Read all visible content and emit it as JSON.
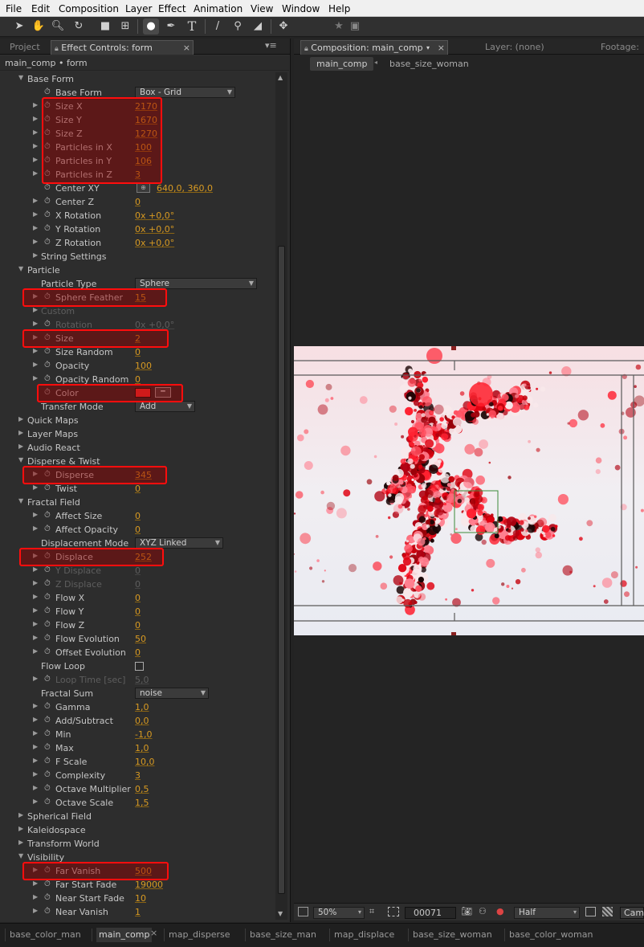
{
  "menu": [
    "File",
    "Edit",
    "Composition",
    "Layer",
    "Effect",
    "Animation",
    "View",
    "Window",
    "Help"
  ],
  "left_tabs": {
    "project": "Project",
    "effect_controls": "Effect Controls: form",
    "close": "×"
  },
  "breadcrumb": "main_comp • form",
  "props": [
    {
      "l": "Base Form",
      "d": 0,
      "t": "o",
      "grp": 1
    },
    {
      "l": "Base Form",
      "d": 2,
      "t": "n",
      "dd": "Box - Grid",
      "sw": 1
    },
    {
      "l": "Size X",
      "d": 2,
      "t": "c",
      "v": "2170",
      "sw": 1
    },
    {
      "l": "Size Y",
      "d": 2,
      "t": "c",
      "v": "1670",
      "sw": 1
    },
    {
      "l": "Size Z",
      "d": 2,
      "t": "c",
      "v": "1270",
      "sw": 1
    },
    {
      "l": "Particles in X",
      "d": 2,
      "t": "c",
      "v": "100",
      "sw": 1
    },
    {
      "l": "Particles in Y",
      "d": 2,
      "t": "c",
      "v": "106",
      "sw": 1
    },
    {
      "l": "Particles in Z",
      "d": 2,
      "t": "c",
      "v": "3",
      "sw": 1
    },
    {
      "l": "Center XY",
      "d": 2,
      "t": "n",
      "v": "640,0, 360,0",
      "sw": 1,
      "xy": 1
    },
    {
      "l": "Center Z",
      "d": 2,
      "t": "c",
      "v": "0",
      "sw": 1
    },
    {
      "l": "X Rotation",
      "d": 2,
      "t": "c",
      "v": "0x +0,0°",
      "sw": 1
    },
    {
      "l": "Y Rotation",
      "d": 2,
      "t": "c",
      "v": "0x +0,0°",
      "sw": 1
    },
    {
      "l": "Z Rotation",
      "d": 2,
      "t": "c",
      "v": "0x +0,0°",
      "sw": 1
    },
    {
      "l": "String Settings",
      "d": 1,
      "t": "c"
    },
    {
      "l": "Particle",
      "d": 0,
      "t": "o",
      "grp": 1
    },
    {
      "l": "Particle Type",
      "d": 1,
      "t": "n",
      "dd": "Sphere"
    },
    {
      "l": "Sphere Feather",
      "d": 2,
      "t": "c",
      "v": "15",
      "sw": 1
    },
    {
      "l": "Custom",
      "d": 1,
      "t": "c",
      "dim": 1
    },
    {
      "l": "Rotation",
      "d": 2,
      "t": "c",
      "v": "0x +0,0°",
      "sw": 1,
      "dim": 1
    },
    {
      "l": "Size",
      "d": 2,
      "t": "c",
      "v": "2",
      "sw": 1
    },
    {
      "l": "Size Random",
      "d": 2,
      "t": "c",
      "v": "0",
      "sw": 1
    },
    {
      "l": "Opacity",
      "d": 2,
      "t": "c",
      "v": "100",
      "sw": 1
    },
    {
      "l": "Opacity Random",
      "d": 2,
      "t": "c",
      "v": "0",
      "sw": 1
    },
    {
      "l": "Color",
      "d": 2,
      "t": "n",
      "sw": 1,
      "color": "#ff3030"
    },
    {
      "l": "Transfer Mode",
      "d": 1,
      "t": "n",
      "dd": "Add"
    },
    {
      "l": "Quick Maps",
      "d": 0,
      "t": "c",
      "grp": 1
    },
    {
      "l": "Layer Maps",
      "d": 0,
      "t": "c",
      "grp": 1
    },
    {
      "l": "Audio React",
      "d": 0,
      "t": "c",
      "grp": 1
    },
    {
      "l": "Disperse & Twist",
      "d": 0,
      "t": "o",
      "grp": 1
    },
    {
      "l": "Disperse",
      "d": 2,
      "t": "c",
      "v": "345",
      "sw": 1
    },
    {
      "l": "Twist",
      "d": 2,
      "t": "c",
      "v": "0",
      "sw": 1
    },
    {
      "l": "Fractal Field",
      "d": 0,
      "t": "o",
      "grp": 1
    },
    {
      "l": "Affect Size",
      "d": 2,
      "t": "c",
      "v": "0",
      "sw": 1
    },
    {
      "l": "Affect Opacity",
      "d": 2,
      "t": "c",
      "v": "0",
      "sw": 1
    },
    {
      "l": "Displacement Mode",
      "d": 1,
      "t": "n",
      "dd": "XYZ Linked"
    },
    {
      "l": "Displace",
      "d": 2,
      "t": "c",
      "v": "252",
      "sw": 1
    },
    {
      "l": "Y Displace",
      "d": 2,
      "t": "c",
      "v": "0",
      "sw": 1,
      "dim": 1
    },
    {
      "l": "Z Displace",
      "d": 2,
      "t": "c",
      "v": "0",
      "sw": 1,
      "dim": 1
    },
    {
      "l": "Flow X",
      "d": 2,
      "t": "c",
      "v": "0",
      "sw": 1
    },
    {
      "l": "Flow Y",
      "d": 2,
      "t": "c",
      "v": "0",
      "sw": 1
    },
    {
      "l": "Flow Z",
      "d": 2,
      "t": "c",
      "v": "0",
      "sw": 1
    },
    {
      "l": "Flow Evolution",
      "d": 2,
      "t": "c",
      "v": "50",
      "sw": 1
    },
    {
      "l": "Offset Evolution",
      "d": 2,
      "t": "c",
      "v": "0",
      "sw": 1
    },
    {
      "l": "Flow Loop",
      "d": 1,
      "t": "n",
      "cb": 1
    },
    {
      "l": "Loop Time [sec]",
      "d": 2,
      "t": "c",
      "v": "5,0",
      "sw": 1,
      "dim": 1
    },
    {
      "l": "Fractal Sum",
      "d": 1,
      "t": "n",
      "dd": "noise"
    },
    {
      "l": "Gamma",
      "d": 2,
      "t": "c",
      "v": "1,0",
      "sw": 1
    },
    {
      "l": "Add/Subtract",
      "d": 2,
      "t": "c",
      "v": "0,0",
      "sw": 1
    },
    {
      "l": "Min",
      "d": 2,
      "t": "c",
      "v": "-1,0",
      "sw": 1
    },
    {
      "l": "Max",
      "d": 2,
      "t": "c",
      "v": "1,0",
      "sw": 1
    },
    {
      "l": "F Scale",
      "d": 2,
      "t": "c",
      "v": "10,0",
      "sw": 1
    },
    {
      "l": "Complexity",
      "d": 2,
      "t": "c",
      "v": "3",
      "sw": 1
    },
    {
      "l": "Octave Multiplier",
      "d": 2,
      "t": "c",
      "v": "0,5",
      "sw": 1
    },
    {
      "l": "Octave Scale",
      "d": 2,
      "t": "c",
      "v": "1,5",
      "sw": 1
    },
    {
      "l": "Spherical Field",
      "d": 0,
      "t": "c",
      "grp": 1
    },
    {
      "l": "Kaleidospace",
      "d": 0,
      "t": "c",
      "grp": 1
    },
    {
      "l": "Transform World",
      "d": 0,
      "t": "c",
      "grp": 1
    },
    {
      "l": "Visibility",
      "d": 0,
      "t": "o",
      "grp": 1
    },
    {
      "l": "Far Vanish",
      "d": 2,
      "t": "c",
      "v": "500",
      "sw": 1
    },
    {
      "l": "Far Start Fade",
      "d": 2,
      "t": "c",
      "v": "19000",
      "sw": 1
    },
    {
      "l": "Near Start Fade",
      "d": 2,
      "t": "c",
      "v": "10",
      "sw": 1
    },
    {
      "l": "Near Vanish",
      "d": 2,
      "t": "c",
      "v": "1",
      "sw": 1
    }
  ],
  "comp_tabs": {
    "composition": "Composition: main_comp",
    "close": "×",
    "layer": "Layer: (none)",
    "footage": "Footage:"
  },
  "comp_crumbs": [
    "main_comp",
    "base_size_woman"
  ],
  "viewer_bar": {
    "zoom": "50%",
    "timecode": "00071",
    "resolution": "Half",
    "camera": "Cam"
  },
  "bottom_tabs": [
    "base_color_man",
    "main_comp",
    "map_disperse",
    "base_size_man",
    "map_displace",
    "base_size_woman",
    "base_color_woman"
  ],
  "accent": "#ff0d0d"
}
